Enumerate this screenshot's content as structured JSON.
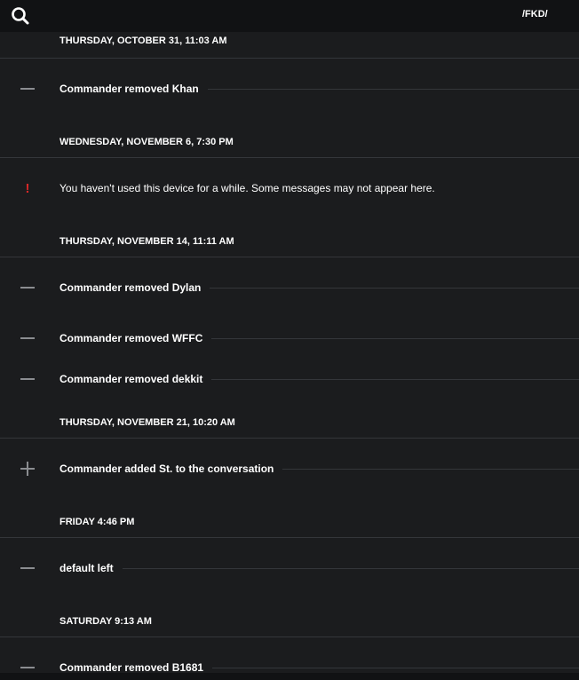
{
  "header": {
    "search_icon": "search-icon",
    "conversation_title": "/FKD/"
  },
  "timeline": [
    {
      "date": "THURSDAY, OCTOBER 31, 11:03 AM",
      "events": [
        {
          "icon": "minus-icon",
          "text": "Commander removed Khan"
        }
      ]
    },
    {
      "date": "WEDNESDAY, NOVEMBER 6, 7:30 PM",
      "events": [
        {
          "icon": "warning-icon",
          "text": "You haven't used this device for a while. Some messages may not appear here."
        }
      ]
    },
    {
      "date": "THURSDAY, NOVEMBER 14, 11:11 AM",
      "events": [
        {
          "icon": "minus-icon",
          "text": "Commander removed Dylan"
        },
        {
          "icon": "minus-icon",
          "text": "Commander removed WFFC"
        },
        {
          "icon": "minus-icon",
          "text": "Commander removed dekkit"
        }
      ]
    },
    {
      "date": "THURSDAY, NOVEMBER 21, 10:20 AM",
      "events": [
        {
          "icon": "plus-icon",
          "text": "Commander added St. to the conversation"
        }
      ]
    },
    {
      "date": "FRIDAY 4:46 PM",
      "events": [
        {
          "icon": "minus-icon",
          "text": "default left"
        }
      ]
    },
    {
      "date": "SATURDAY 9:13 AM",
      "events": [
        {
          "icon": "minus-icon",
          "text": "Commander removed B1681"
        }
      ]
    }
  ],
  "colors": {
    "background": "#1b1c1e",
    "topbar": "#111214",
    "divider": "#34363a",
    "icon_gray": "#8b8d91",
    "warning_red": "#d82828",
    "text": "#ffffff"
  }
}
